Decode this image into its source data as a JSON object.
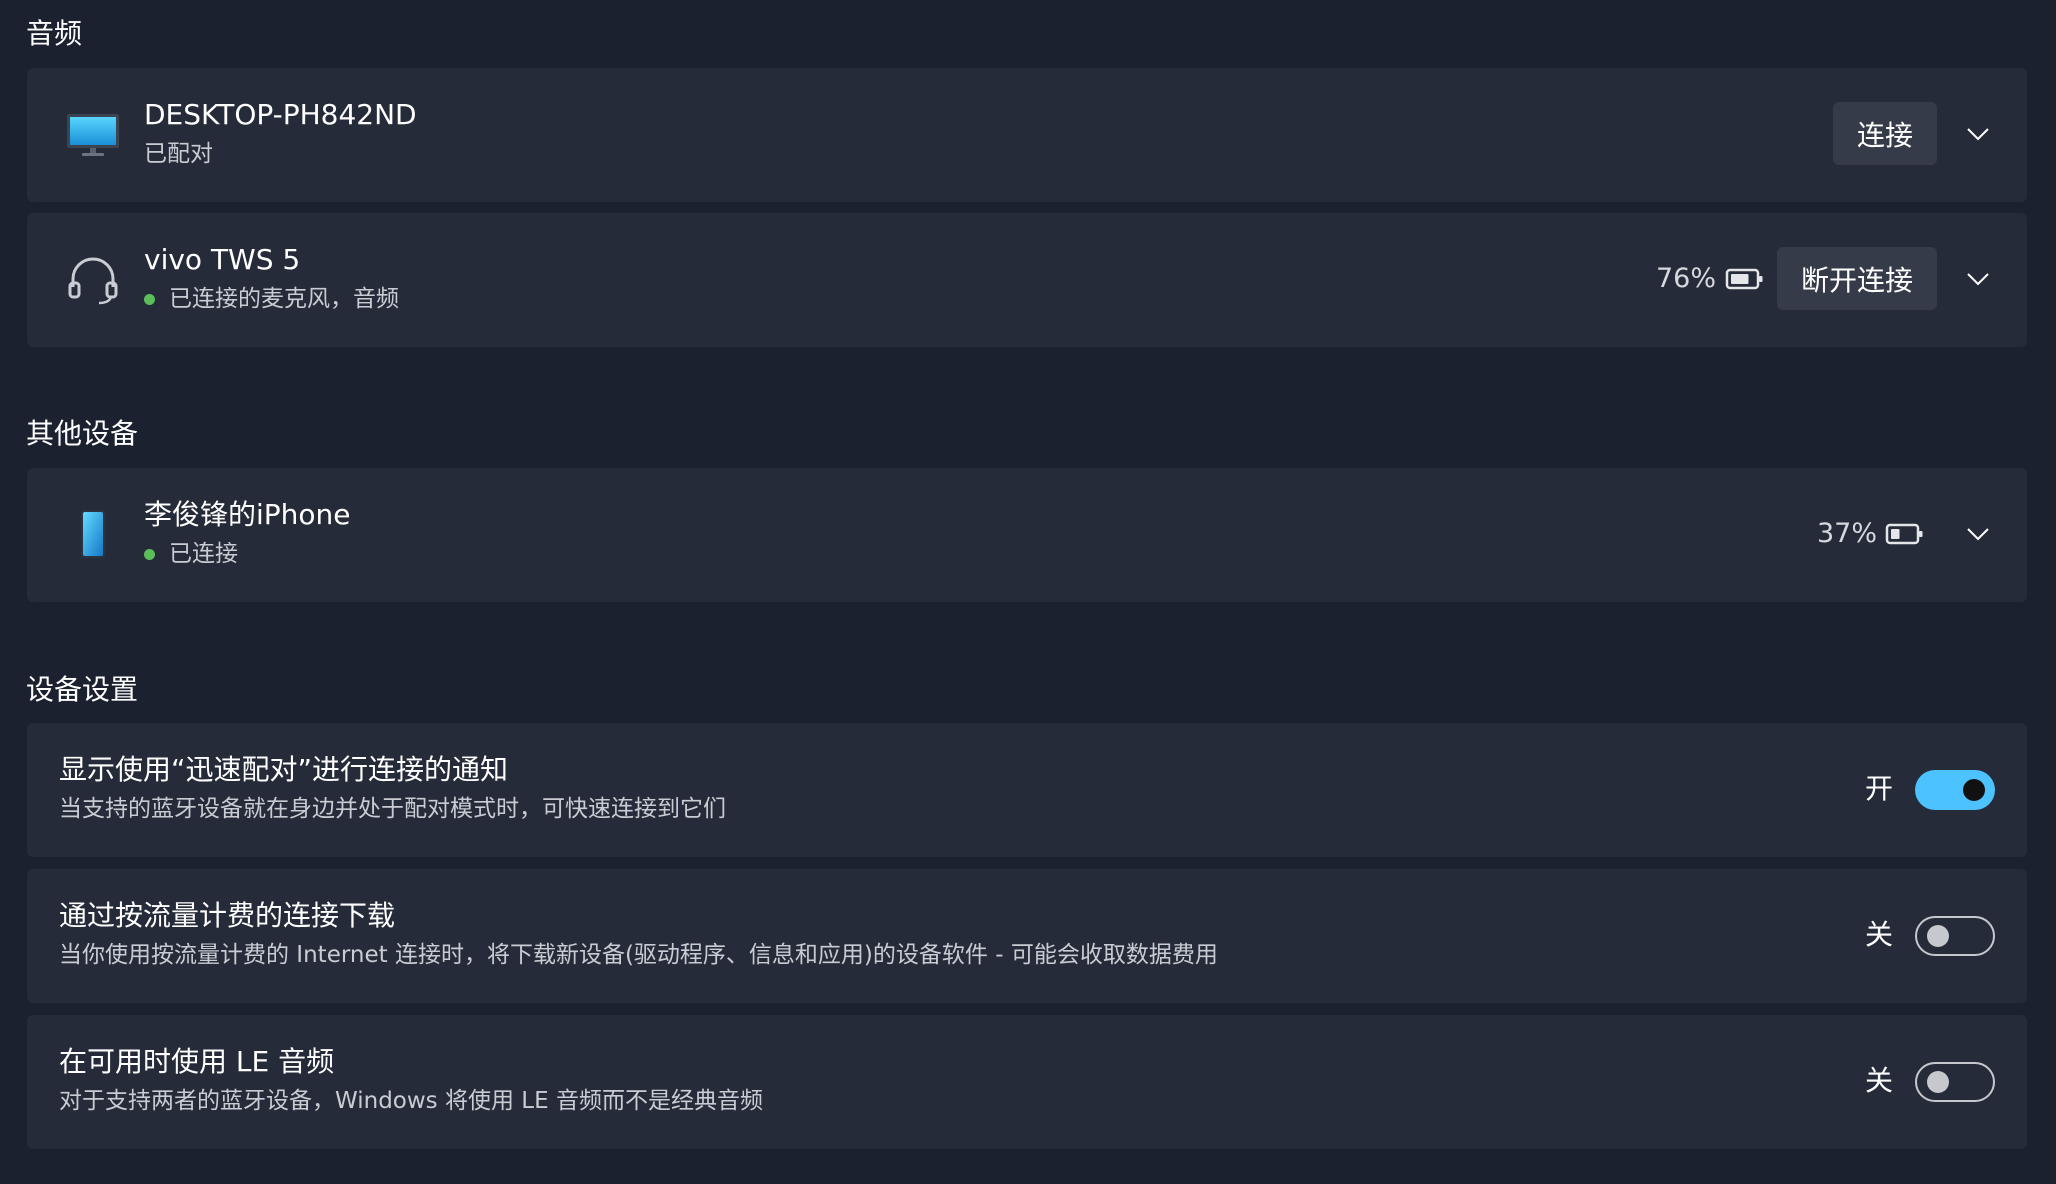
{
  "sections": {
    "audio": "音频",
    "other_devices": "其他设备",
    "device_settings": "设备设置"
  },
  "devices": [
    {
      "name": "DESKTOP-PH842ND",
      "status": "已配对",
      "icon": "monitor-icon",
      "action_label": "连接"
    },
    {
      "name": "vivo TWS 5",
      "status": "已连接的麦克风，音频",
      "icon": "headset-icon",
      "battery": "76%",
      "battery_level": 0.76,
      "action_label": "断开连接"
    },
    {
      "name": "李俊锋的iPhone",
      "status": "已连接",
      "icon": "phone-icon",
      "battery": "37%",
      "battery_level": 0.37
    }
  ],
  "settings": [
    {
      "title": "显示使用“迅速配对”进行连接的通知",
      "description": "当支持的蓝牙设备就在身边并处于配对模式时，可快速连接到它们",
      "state_label": "开",
      "on": true
    },
    {
      "title": "通过按流量计费的连接下载",
      "description": "当你使用按流量计费的 Internet 连接时，将下载新设备(驱动程序、信息和应用)的设备软件 - 可能会收取数据费用",
      "state_label": "关",
      "on": false
    },
    {
      "title": "在可用时使用 LE 音频",
      "description": "对于支持两者的蓝牙设备，Windows 将使用 LE 音频而不是经典音频",
      "state_label": "关",
      "on": false
    }
  ],
  "colors": {
    "background": "#1c2130",
    "card": "#252b38",
    "button": "#353b48",
    "accent": "#4cc2ff",
    "connected_dot": "#5bbe5b"
  }
}
